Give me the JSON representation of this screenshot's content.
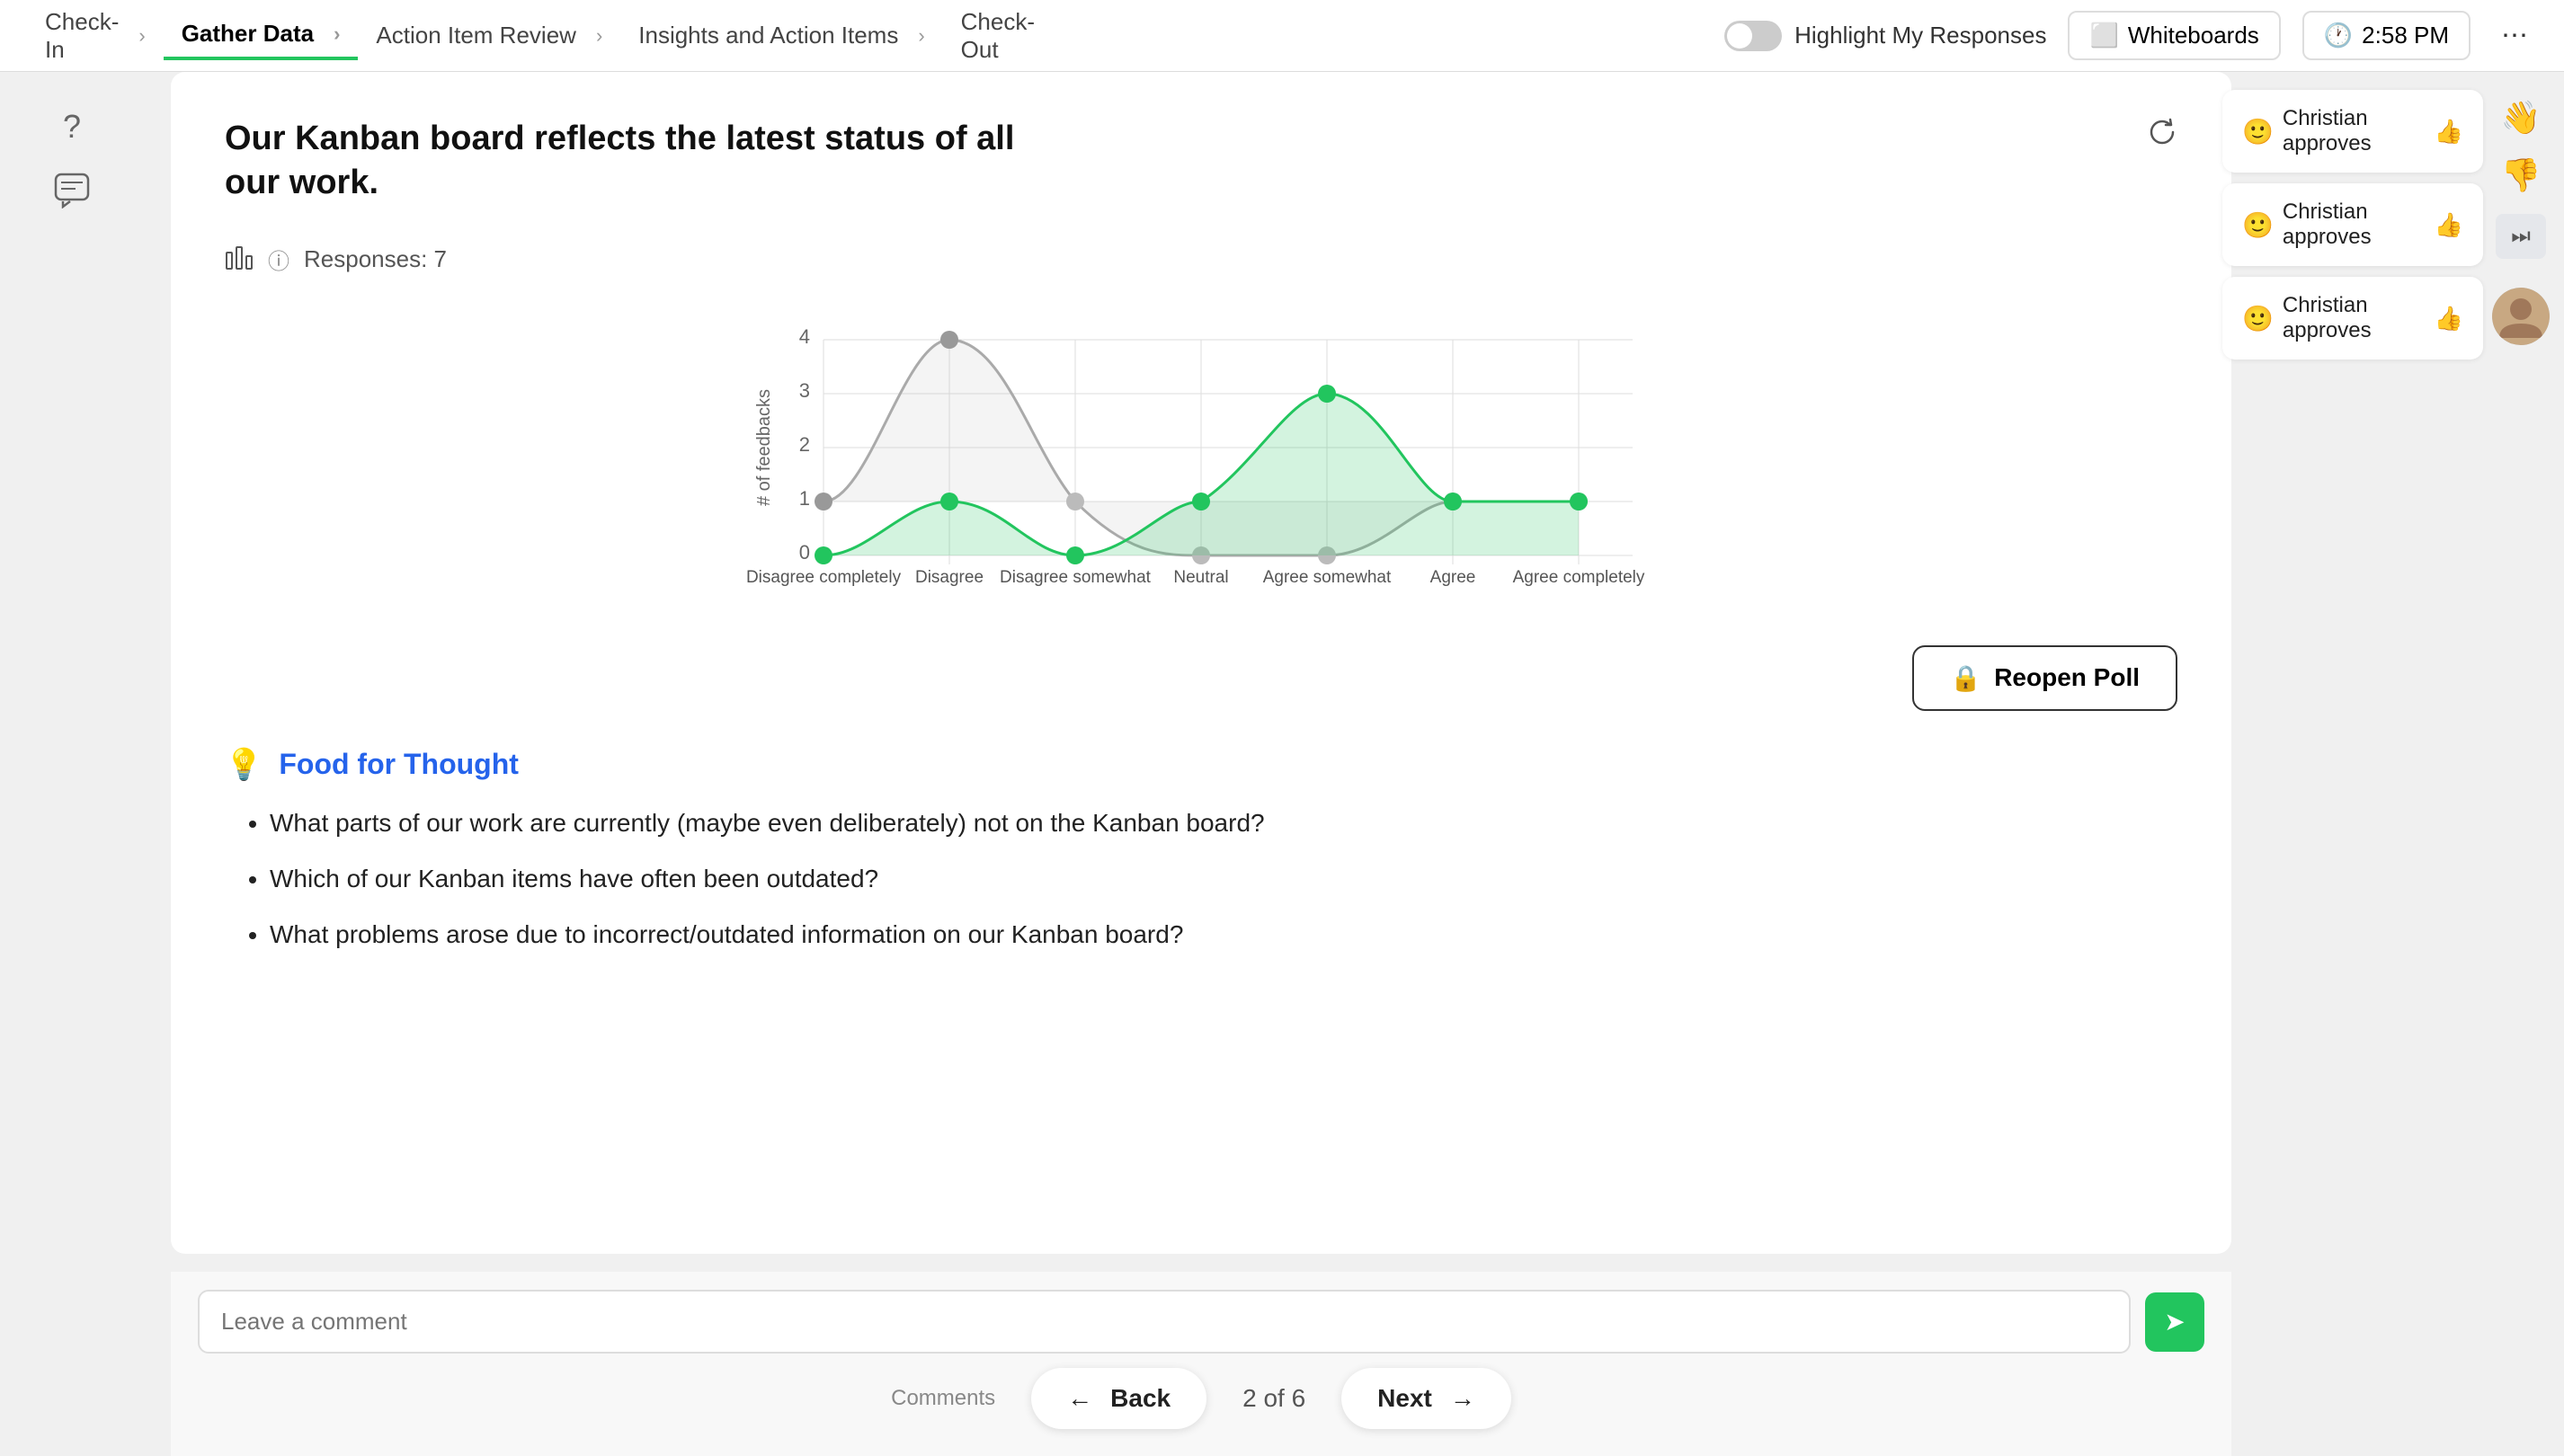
{
  "nav": {
    "steps": [
      {
        "id": "check-in",
        "label": "Check-\nIn",
        "active": false
      },
      {
        "id": "gather-data",
        "label": "Gather Data",
        "active": true
      },
      {
        "id": "action-item-review",
        "label": "Action Item Review",
        "active": false
      },
      {
        "id": "insights-action-items",
        "label": "Insights and Action Items",
        "active": false
      },
      {
        "id": "check-out",
        "label": "Check-\nOut",
        "active": false
      }
    ],
    "highlight_label": "Highlight My Responses",
    "whiteboards_label": "Whiteboards",
    "time_label": "2:58 PM"
  },
  "sidebar": {
    "icons": [
      {
        "id": "help-icon",
        "symbol": "?"
      },
      {
        "id": "chat-icon",
        "symbol": "💬"
      }
    ]
  },
  "card": {
    "title": "Our Kanban board reflects the latest status of all our work.",
    "responses_label": "Responses: 7",
    "chart": {
      "y_label": "# of feedbacks",
      "x_labels": [
        "Disagree completely",
        "Disagree",
        "Disagree somewhat",
        "Neutral",
        "Agree somewhat",
        "Agree",
        "Agree completely"
      ],
      "y_max": 4,
      "y_ticks": [
        0,
        1,
        2,
        3,
        4
      ],
      "green_values": [
        0,
        1,
        0,
        1,
        3,
        1,
        1
      ],
      "grey_values": [
        1,
        4,
        1,
        0,
        0,
        1,
        1
      ]
    },
    "reopen_poll_label": "Reopen Poll",
    "food_for_thought": {
      "title": "Food for Thought",
      "items": [
        "What parts of our work are currently (maybe even deliberately) not on the Kanban board?",
        "Which of our Kanban items have often been outdated?",
        "What problems arose due to incorrect/outdated information on our Kanban board?"
      ]
    }
  },
  "bottom": {
    "comment_placeholder": "Leave a comment",
    "comment_section_label": "Comments",
    "pagination": {
      "back_label": "Back",
      "next_label": "Next",
      "page_indicator": "2 of 6"
    }
  },
  "reactions": [
    {
      "id": "reaction-1",
      "emoji": "🙂",
      "text": "Christian approves",
      "icon": "👍"
    },
    {
      "id": "reaction-2",
      "emoji": "🙂",
      "text": "Christian approves",
      "icon": "👍"
    },
    {
      "id": "reaction-3",
      "emoji": "🙂",
      "text": "Christian approves",
      "icon": "👍"
    }
  ],
  "emoji_sidebar": [
    "👋",
    "👎",
    "⏭️"
  ]
}
